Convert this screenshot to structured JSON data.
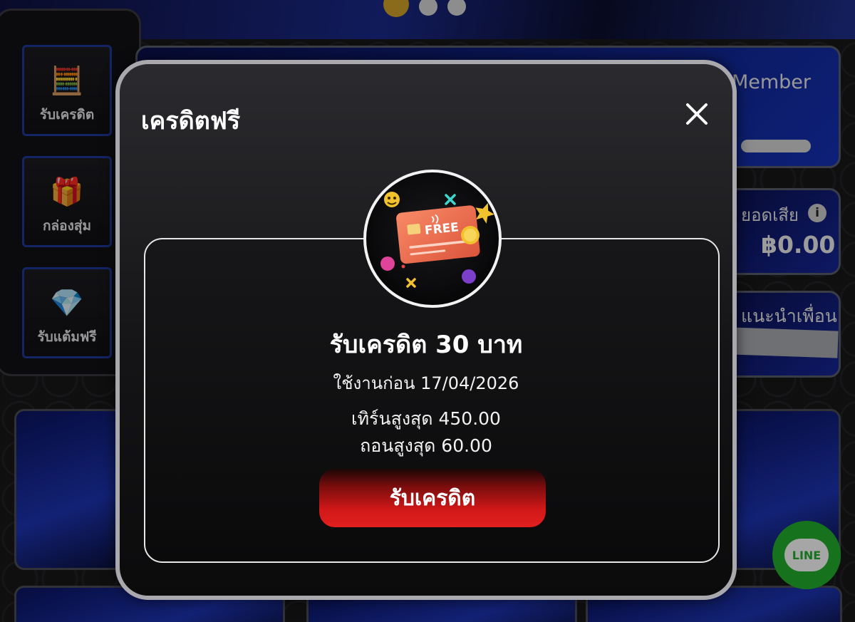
{
  "carousel": {
    "dots": 3,
    "active_index": 0
  },
  "side_menu": {
    "items": [
      {
        "label": "รับเครดิต",
        "icon": "credit-machine-icon"
      },
      {
        "label": "กล่องสุ่ม",
        "icon": "mystery-box-icon"
      },
      {
        "label": "รับแต้มฟรี",
        "icon": "diamond-icon"
      }
    ]
  },
  "right_cards": {
    "member_label": "Member",
    "loss_label": "ยอดเสีย",
    "loss_amount": "฿0.00",
    "refer_label": "แนะนำเพื่อน"
  },
  "line_button": {
    "label": "LINE"
  },
  "modal": {
    "title": "เครดิตฟรี",
    "badge_text": "FREE",
    "credit_title": "รับเครดิต 30 บาท",
    "expiry": "ใช้งานก่อน 17/04/2026",
    "turnover": "เทิร์นสูงสุด 450.00",
    "withdraw": "ถอนสูงสุด 60.00",
    "claim_label": "รับเครดิต"
  },
  "colors": {
    "accent_red": "#e21f1f",
    "brand_blue": "#1d34b4",
    "gold": "#d4a52a",
    "line_green": "#22b02c"
  }
}
